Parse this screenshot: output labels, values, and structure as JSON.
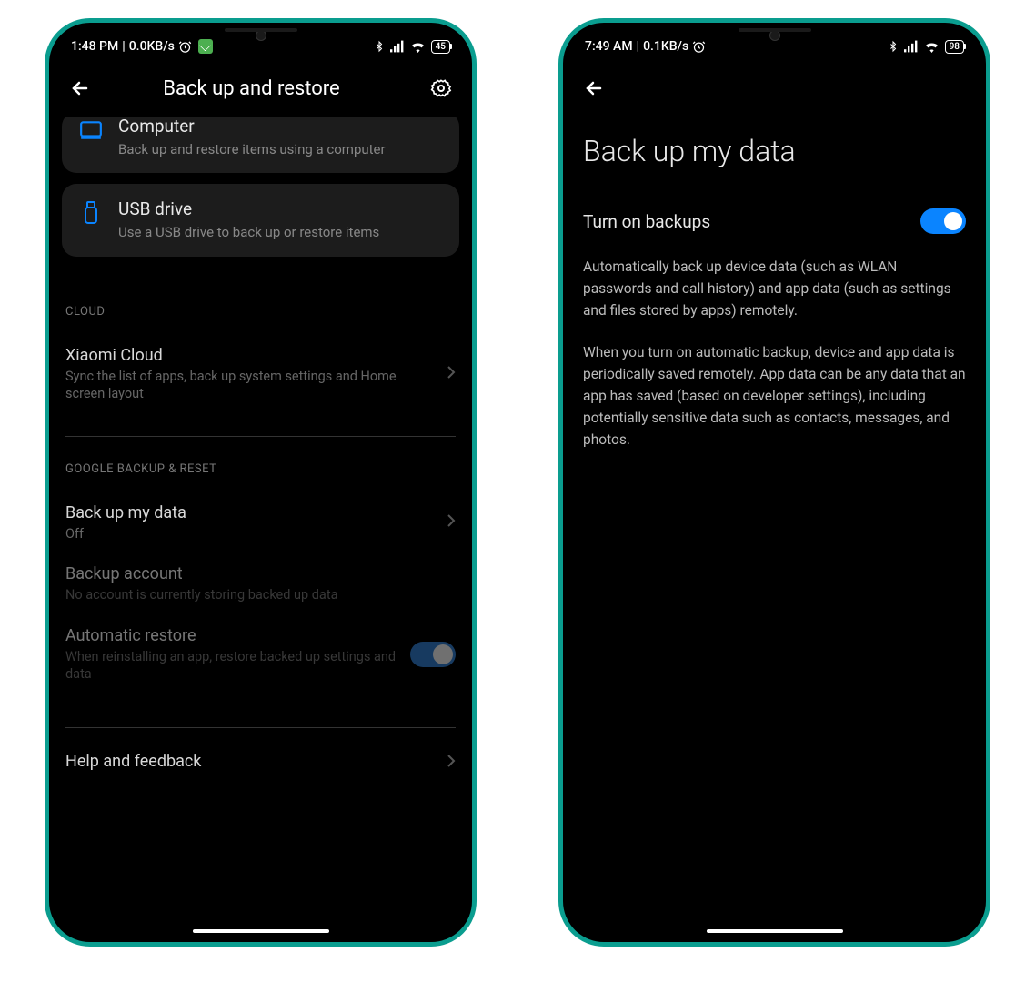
{
  "phone1": {
    "status": {
      "time": "1:48 PM",
      "speed": "0.0KB/s",
      "battery": "45"
    },
    "header": {
      "title": "Back up and restore"
    },
    "cards": {
      "computer": {
        "title": "Computer",
        "sub": "Back up and restore items using a computer"
      },
      "usb": {
        "title": "USB drive",
        "sub": "Use a USB drive to back up or restore items"
      }
    },
    "sections": {
      "cloud": {
        "label": "CLOUD",
        "item": {
          "title": "Xiaomi Cloud",
          "sub": "Sync the list of apps, back up system settings and Home screen layout"
        }
      },
      "google": {
        "label": "GOOGLE BACKUP & RESET",
        "backup_data": {
          "title": "Back up my data",
          "sub": "Off"
        },
        "backup_account": {
          "title": "Backup account",
          "sub": "No account is currently storing backed up data"
        },
        "auto_restore": {
          "title": "Automatic restore",
          "sub": "When reinstalling an app, restore backed up settings and data"
        }
      }
    },
    "footer": {
      "help": "Help and feedback"
    }
  },
  "phone2": {
    "status": {
      "time": "7:49 AM",
      "speed": "0.1KB/s",
      "battery": "98"
    },
    "title": "Back up my data",
    "toggle_label": "Turn on backups",
    "para1": "Automatically back up device data (such as WLAN passwords and call history) and app data (such as settings and files stored by apps) remotely.",
    "para2": "When you turn on automatic backup, device and app data is periodically saved remotely. App data can be any data that an app has saved (based on developer settings), including potentially sensitive data such as contacts, messages, and photos."
  }
}
